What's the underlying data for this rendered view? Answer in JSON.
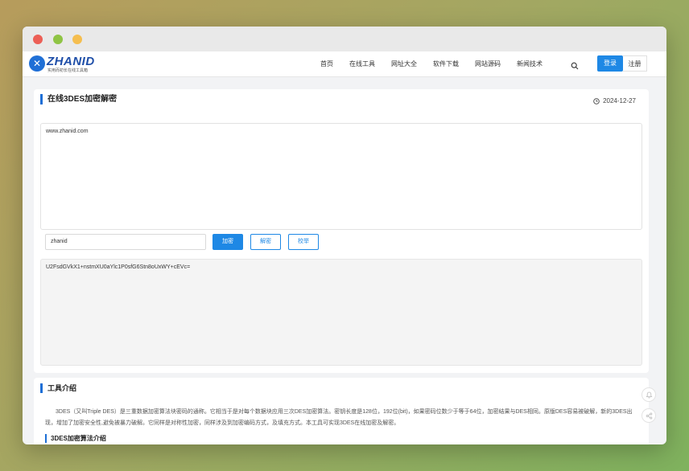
{
  "window": {
    "controls": [
      "close",
      "minimize",
      "maximize"
    ]
  },
  "nav": {
    "logo_text": "ZHANID",
    "logo_sub": "实用而初长在线工具箱",
    "links": [
      "首页",
      "在线工具",
      "网址大全",
      "软件下载",
      "网站源码",
      "新闻技术"
    ],
    "search_icon": "search-icon",
    "login_label": "登录",
    "register_label": "注册"
  },
  "tool": {
    "title": "在线3DES加密解密",
    "date": "2024-12-27",
    "input_text": "www.zhanid.com",
    "key_value": "zhanid",
    "encrypt_label": "加密",
    "decrypt_label": "解密",
    "proofread_label": "校举",
    "output_text": "U2FsdGVkX1+nstmXU0aYlc1P0sfG6Stn8oUxWY+cEVc="
  },
  "intro": {
    "title": "工具介绍",
    "text": "3DES（又叫Triple DES）是三重数据加密算法块密码的通称。它相当于是对每个数据块应用三次DES加密算法。密钥长度是128位，192位(bit)，如果密码位数少于等于64位，加密结果与DES相同。原版DES容易被破解，新的3DES出现，增加了加密安全性,避免被暴力破解。它同样是对称性加密，同样涉及到加密编码方式，及填充方式。本工具可实现3DES在线加密及解密。",
    "subtitle": "3DES加密算法介绍"
  },
  "colors": {
    "accent": "#1e88e5",
    "title_bar": "#1e6fd6",
    "brand": "#1e4ea8"
  }
}
